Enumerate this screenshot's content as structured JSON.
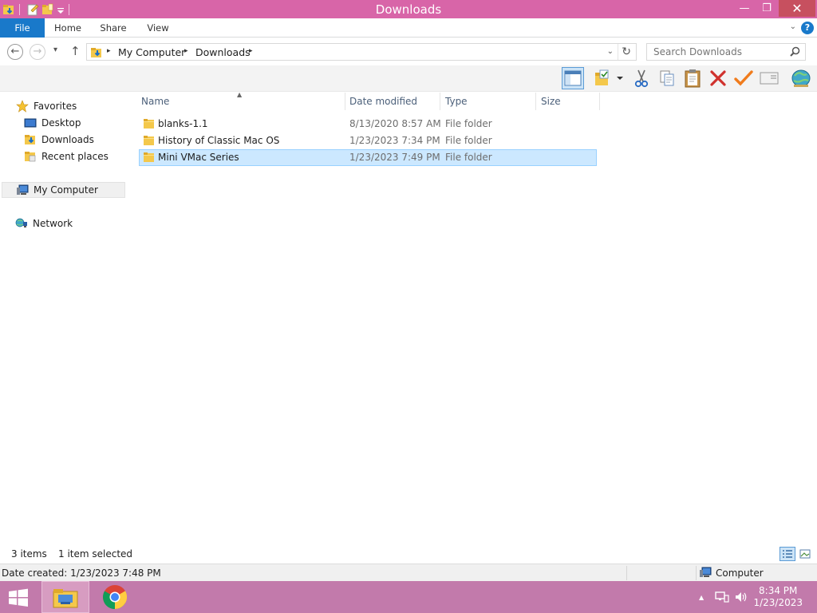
{
  "window": {
    "title": "Downloads",
    "minimize": "—",
    "maximize": "❐",
    "close": "✕"
  },
  "ribbon": {
    "tabs": [
      {
        "label": "File"
      },
      {
        "label": "Home"
      },
      {
        "label": "Share"
      },
      {
        "label": "View"
      }
    ],
    "expand": "⌄",
    "help": "?"
  },
  "nav": {
    "back": "←",
    "forward": "→",
    "recent": "▾",
    "up": "↑",
    "breadcrumb": [
      "My Computer",
      "Downloads"
    ],
    "crumb_sep": "▸",
    "dropdown": "⌄",
    "refresh": "↻"
  },
  "search": {
    "placeholder": "Search Downloads"
  },
  "navpane": {
    "favorites": "Favorites",
    "desktop": "Desktop",
    "downloads": "Downloads",
    "recent_places": "Recent places",
    "my_computer": "My Computer",
    "network": "Network"
  },
  "filelist": {
    "columns": [
      "Name",
      "Date modified",
      "Type",
      "Size"
    ],
    "sort_indicator": "▲",
    "rows": [
      {
        "name": "blanks-1.1",
        "date": "8/13/2020 8:57 AM",
        "type": "File folder",
        "size": ""
      },
      {
        "name": "History of Classic Mac OS",
        "date": "1/23/2023 7:34 PM",
        "type": "File folder",
        "size": ""
      },
      {
        "name": "Mini VMac Series",
        "date": "1/23/2023 7:49 PM",
        "type": "File folder",
        "size": "",
        "selected": true
      }
    ]
  },
  "status": {
    "item_count": "3 items",
    "selected": "1 item selected"
  },
  "details": {
    "date_created": "Date created: 1/23/2023 7:48 PM",
    "zone": "Computer"
  },
  "taskbar": {
    "clock_time": "8:34 PM",
    "clock_date": "1/23/2023",
    "tray_expand": "▲"
  },
  "colors": {
    "titlebar": "#d865a8",
    "taskbar": "#c27aab",
    "file_tab": "#1979ca",
    "selection": "#cce8ff"
  }
}
